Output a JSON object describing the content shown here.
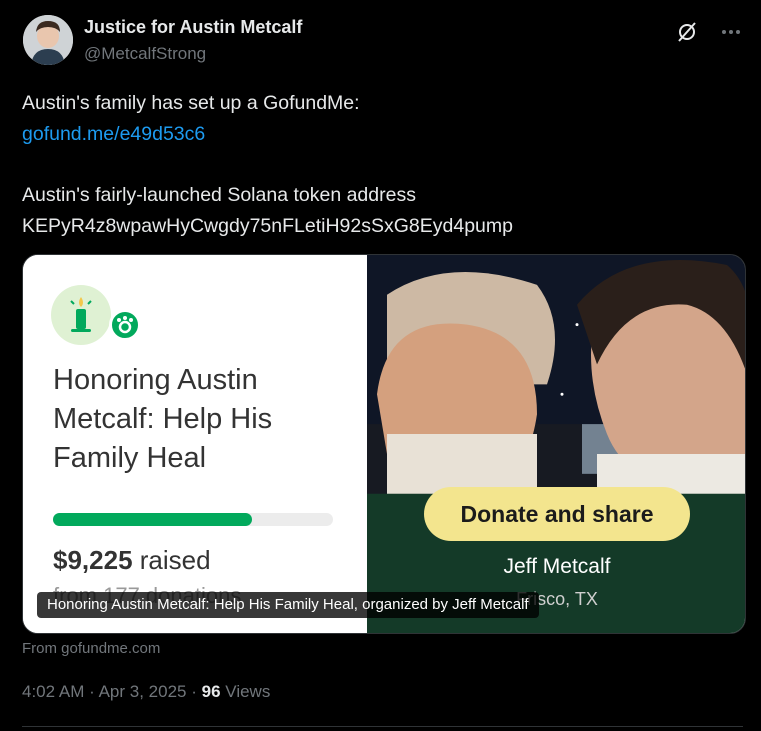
{
  "author": {
    "name": "Justice for Austin Metcalf",
    "handle": "@MetcalfStrong"
  },
  "tweet": {
    "line1": "Austin's family has set up a GofundMe:",
    "link": "gofund.me/e49d53c6",
    "line2": "Austin's fairly-launched Solana token address",
    "token_address": "KEPyR4z8wpawHyCwgdy75nFLetiH92sSxG8Eyd4pump"
  },
  "card": {
    "campaign_title": "Honoring Austin Metcalf: Help His Family Heal",
    "raised_amount": "$9,225",
    "raised_label": "raised",
    "progress_fraction": 0.71,
    "from_text": "from 177 donations",
    "donate_label": "Donate and share",
    "organizer_name": "Jeff Metcalf",
    "location": "Frisco, TX",
    "caption": "Honoring Austin Metcalf: Help His Family Heal, organized by Jeff Metcalf",
    "source": "From gofundme.com"
  },
  "meta": {
    "time": "4:02 AM",
    "separator": "·",
    "date": "Apr 3, 2025",
    "views_count": "96",
    "views_label": "Views"
  },
  "icons": {
    "top": [
      "grok-icon",
      "more-icon"
    ]
  },
  "colors": {
    "background": "#000000",
    "text": "#e7e9ea",
    "secondary": "#71767b",
    "link": "#1d9bf0",
    "gofundme_green": "#02a95c",
    "donate_button": "#f3e58e"
  }
}
